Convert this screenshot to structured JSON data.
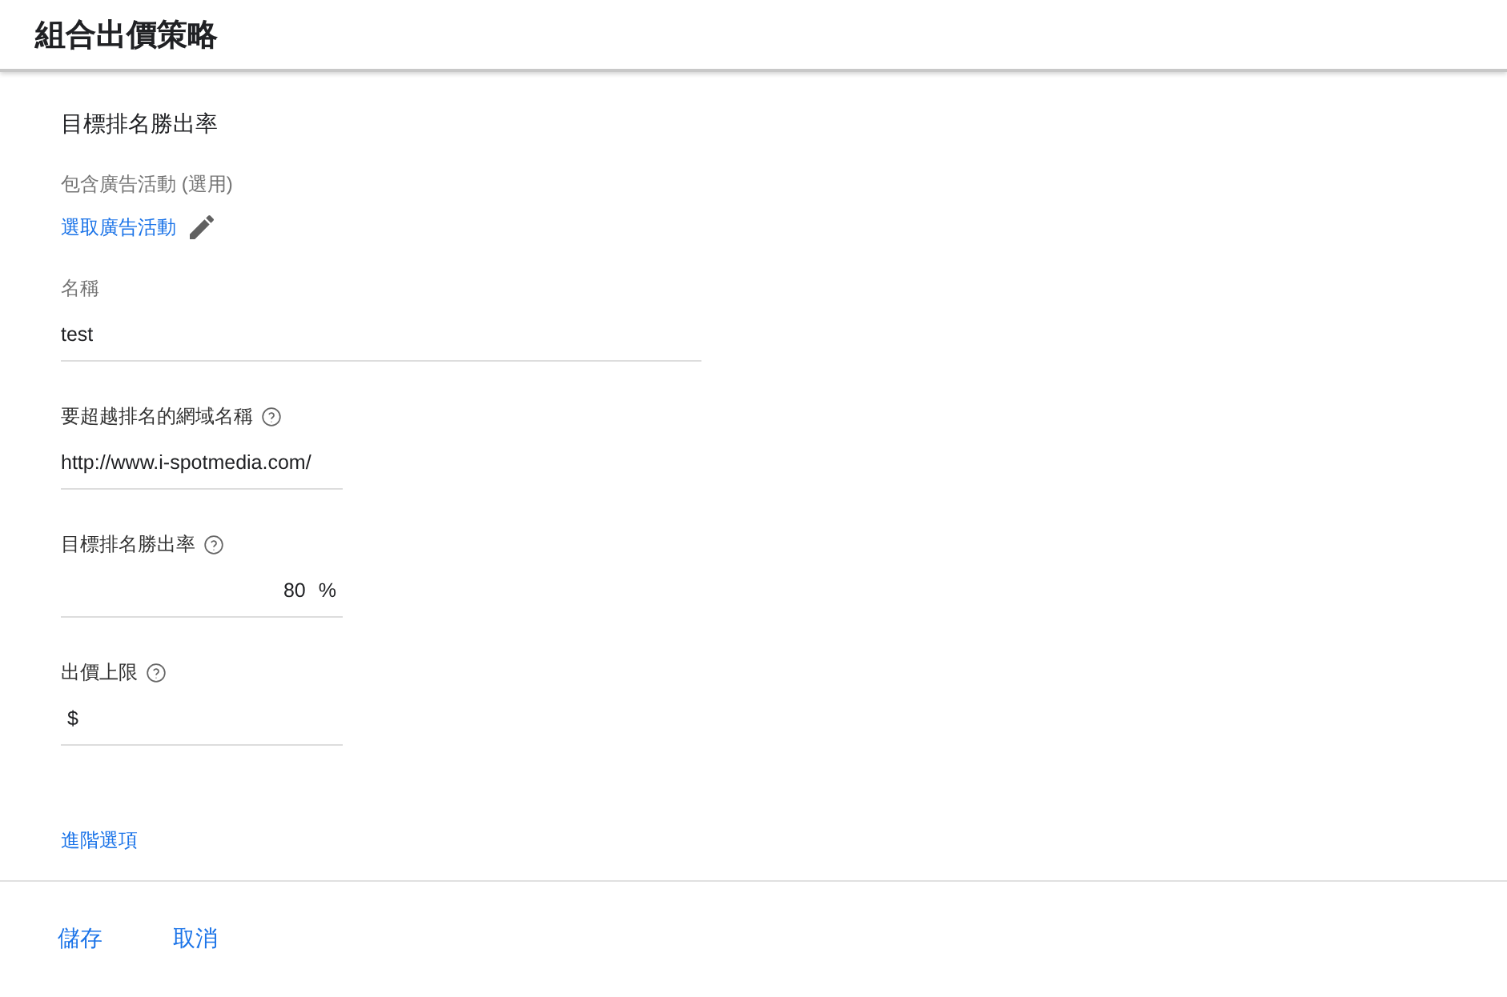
{
  "header": {
    "title": "組合出價策略"
  },
  "section_title": "目標排名勝出率",
  "campaigns": {
    "label": "包含廣告活動 (選用)",
    "link": "選取廣告活動"
  },
  "fields": [
    {
      "label": "名稱",
      "help": false,
      "wide": true,
      "value": "test"
    },
    {
      "label": "要超越排名的網域名稱",
      "help": true,
      "wide": false,
      "value": "http://www.i-spotmedia.com/"
    },
    {
      "label": "目標排名勝出率",
      "help": true,
      "wide": false,
      "value": "80",
      "suffix": "%"
    },
    {
      "label": "出價上限",
      "help": true,
      "wide": false,
      "prefix": "$"
    }
  ],
  "advanced_link": "進階選項",
  "buttons": [
    "儲存",
    "取消"
  ]
}
